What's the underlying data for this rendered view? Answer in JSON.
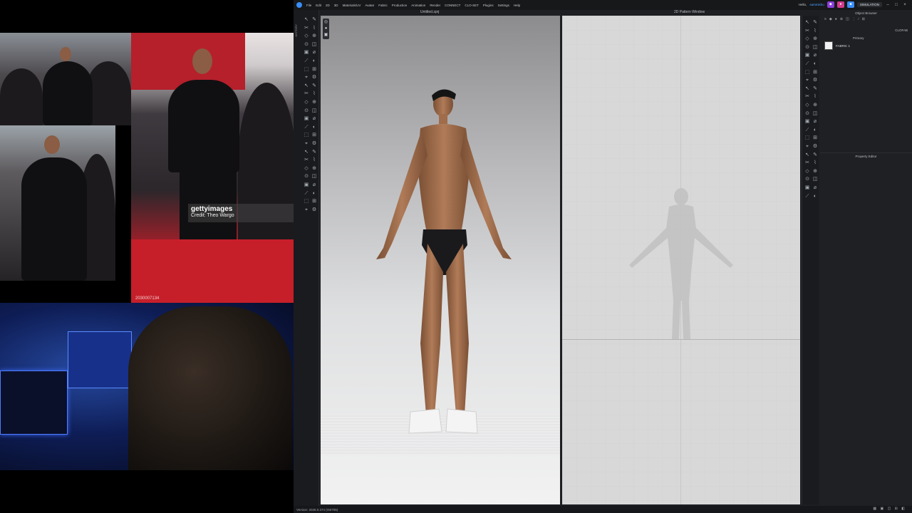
{
  "collage": {
    "watermark_logo": "gettyimages",
    "watermark_credit": "Credit: Theo Wargo",
    "image_id": "2030007134"
  },
  "app": {
    "menu": [
      "File",
      "Edit",
      "2D",
      "3D",
      "Materials/UV",
      "Avatar",
      "Fabric",
      "Production",
      "Animation",
      "Render",
      "CONNECT",
      "CLO-SET",
      "Plugins",
      "Settings",
      "Help"
    ],
    "user_greeting": "Hello,",
    "user_name": "sammishu",
    "mode": "SIMULATION",
    "left_tab": "HISTORY",
    "view3d_title": "Untitled.zprj",
    "view2d_title": "2D Pattern Window",
    "object_browser_title": "Object Browser",
    "clofab_label": "CLOFAB",
    "primary_label": "Primary",
    "fabric_name": "FABRIC 1",
    "property_editor_title": "Property Editor",
    "version": "Version: 2026.0.374 (r50705)",
    "accent_color": "#3a8df6",
    "icons": [
      "pointer-icon",
      "pen-icon",
      "cut-icon",
      "fold-icon",
      "pin-icon",
      "measure-icon",
      "gear-icon",
      "eye-icon",
      "grid-icon"
    ]
  }
}
